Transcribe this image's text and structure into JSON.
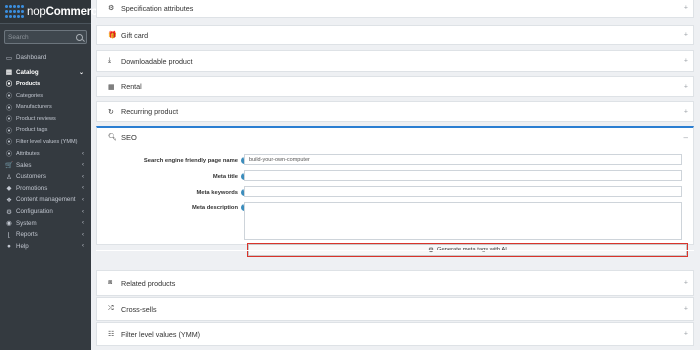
{
  "brand": {
    "name_light": "nop",
    "name_bold": "Commerce"
  },
  "search": {
    "placeholder": "Search"
  },
  "sidebar": {
    "items": [
      {
        "label": "Dashboard",
        "icon": "desktop-icon",
        "glyph": "▭",
        "chevron": ""
      },
      {
        "label": "Catalog",
        "icon": "catalog-icon",
        "glyph": "▤",
        "chevron": "⌄"
      },
      {
        "label": "Products",
        "icon": "circle-dot-icon",
        "glyph": "⦿",
        "chevron": ""
      },
      {
        "label": "Categories",
        "icon": "circle-dot-icon",
        "glyph": "⦿",
        "chevron": ""
      },
      {
        "label": "Manufacturers",
        "icon": "circle-dot-icon",
        "glyph": "⦿",
        "chevron": ""
      },
      {
        "label": "Product reviews",
        "icon": "circle-dot-icon",
        "glyph": "⦿",
        "chevron": ""
      },
      {
        "label": "Product tags",
        "icon": "circle-dot-icon",
        "glyph": "⦿",
        "chevron": ""
      },
      {
        "label": "Filter level values (YMM)",
        "icon": "circle-dot-icon",
        "glyph": "⦿",
        "chevron": ""
      },
      {
        "label": "Attributes",
        "icon": "circle-dot-icon",
        "glyph": "⦿",
        "chevron": "‹"
      },
      {
        "label": "Sales",
        "icon": "cart-icon",
        "glyph": "🛒",
        "chevron": "‹"
      },
      {
        "label": "Customers",
        "icon": "user-icon",
        "glyph": "♙",
        "chevron": "‹"
      },
      {
        "label": "Promotions",
        "icon": "tag-icon",
        "glyph": "◆",
        "chevron": "‹"
      },
      {
        "label": "Content management",
        "icon": "cubes-icon",
        "glyph": "❖",
        "chevron": "‹"
      },
      {
        "label": "Configuration",
        "icon": "gears-icon",
        "glyph": "⚙",
        "chevron": "‹"
      },
      {
        "label": "System",
        "icon": "cube-icon",
        "glyph": "◉",
        "chevron": "‹"
      },
      {
        "label": "Reports",
        "icon": "chart-icon",
        "glyph": "⌊",
        "chevron": "‹"
      },
      {
        "label": "Help",
        "icon": "question-icon",
        "glyph": "●",
        "chevron": "‹"
      }
    ]
  },
  "panels": {
    "specification": {
      "title": "Specification attributes",
      "glyph": "⚙"
    },
    "gift_card": {
      "title": "Gift card",
      "glyph": "🎁"
    },
    "downloadable": {
      "title": "Downloadable product",
      "glyph": "⤓"
    },
    "rental": {
      "title": "Rental",
      "glyph": "▦"
    },
    "recurring": {
      "title": "Recurring product",
      "glyph": "↻"
    },
    "related": {
      "title": "Related products",
      "glyph": "⧈"
    },
    "cross_sells": {
      "title": "Cross-sells",
      "glyph": "⤮"
    },
    "filter_level": {
      "title": "Filter level values (YMM)",
      "glyph": "☷"
    },
    "expand_symbol": "+",
    "collapse_symbol": "–"
  },
  "seo": {
    "title": "SEO",
    "fields": {
      "friendly_label": "Search engine friendly page name",
      "friendly_value": "build-your-own-computer",
      "meta_title_label": "Meta title",
      "meta_title_value": "",
      "meta_keywords_label": "Meta keywords",
      "meta_keywords_value": "",
      "meta_description_label": "Meta description",
      "meta_description_value": ""
    },
    "help_glyph": "?",
    "ai_button_label": "Generate meta tags with AI"
  },
  "colors": {
    "sidebar_bg": "#343a40",
    "accent": "#2b7ed1",
    "highlight_border": "#d9342b",
    "help_icon": "#3c8dbc"
  }
}
